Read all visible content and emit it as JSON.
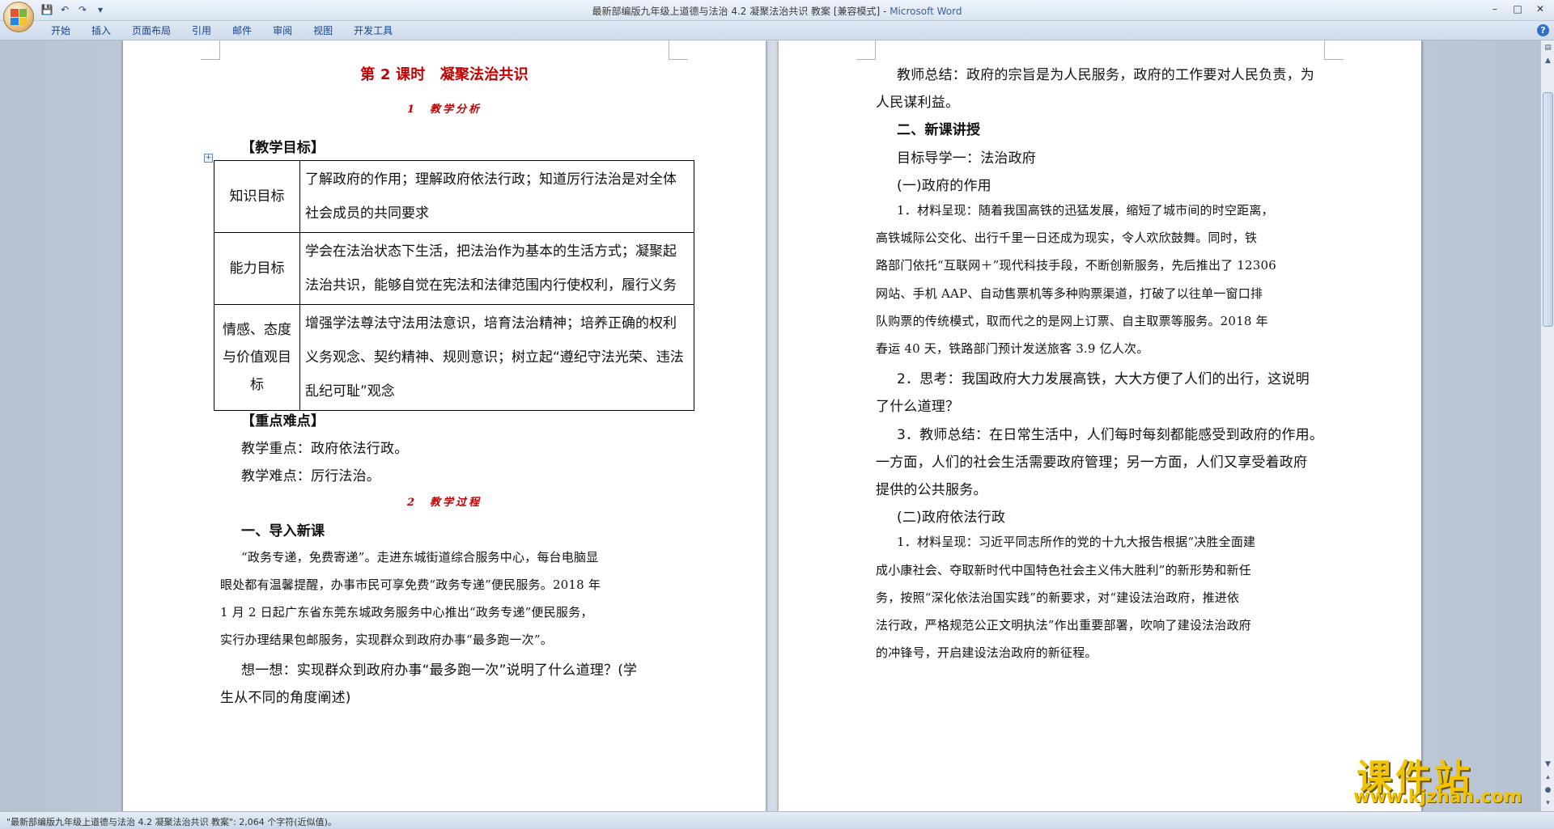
{
  "window": {
    "title": "最新部编版九年级上道德与法治 4.2 凝聚法治共识 教案 [兼容模式] - ",
    "app": "Microsoft Word"
  },
  "ribbon": {
    "tabs": [
      "开始",
      "插入",
      "页面布局",
      "引用",
      "邮件",
      "审阅",
      "视图",
      "开发工具"
    ]
  },
  "left_page": {
    "title": "第 2 课时　凝聚法治共识",
    "section1": "1　教学分析",
    "goals_heading": "【教学目标】",
    "goals": [
      {
        "label": "知识目标",
        "text": "了解政府的作用；理解政府依法行政；知道厉行法治是对全体社会成员的共同要求"
      },
      {
        "label": "能力目标",
        "text": "学会在法治状态下生活，把法治作为基本的生活方式；凝聚起法治共识，能够自觉在宪法和法律范围内行使权利，履行义务"
      },
      {
        "label": "情感、态度与价值观目标",
        "text": "增强学法尊法守法用法意识，培育法治精神；培养正确的权利义务观念、契约精神、规则意识；树立起“遵纪守法光荣、违法乱纪可耻”观念"
      }
    ],
    "key_heading": "【重点难点】",
    "key_point": "教学重点：政府依法行政。",
    "difficulty": "教学难点：厉行法治。",
    "section2": "2　教学过程",
    "intro_heading": "一、导入新课",
    "intro_lines": [
      "“政务专递，免费寄递”。走进东城街道综合服务中心，每台电脑显",
      "眼处都有温馨提醒，办事市民可享免费“政务专递”便民服务。2018 年",
      "1 月 2 日起广东省东莞东城政务服务中心推出“政务专递”便民服务，",
      "实行办理结果包邮服务，实现群众到政府办事“最多跑一次”。"
    ],
    "think_lines": [
      "想一想：实现群众到政府办事“最多跑一次”说明了什么道理？(学",
      "生从不同的角度阐述)"
    ]
  },
  "right_page": {
    "lines": [
      {
        "t": "教师总结：政府的宗旨是为人民服务，政府的工作要对人民负责，为",
        "style": "normal",
        "indent": true
      },
      {
        "t": "人民谋利益。",
        "style": "normal",
        "indent": false
      },
      {
        "t": "二、新课讲授",
        "style": "bold",
        "indent": true
      },
      {
        "t": "目标导学一：法治政府",
        "style": "normal",
        "indent": true
      },
      {
        "t": "(一)政府的作用",
        "style": "normal",
        "indent": true
      },
      {
        "t": "1．材料呈现：随着我国高铁的迅猛发展，缩短了城市间的时空距离，",
        "style": "serif",
        "indent": true
      },
      {
        "t": "高铁城际公交化、出行千里一日还成为现实，令人欢欣鼓舞。同时，铁",
        "style": "serif",
        "indent": false
      },
      {
        "t": "路部门依托“互联网＋”现代科技手段，不断创新服务，先后推出了 12306",
        "style": "serif",
        "indent": false
      },
      {
        "t": "网站、手机 AAP、自动售票机等多种购票渠道，打破了以往单一窗口排",
        "style": "serif",
        "indent": false
      },
      {
        "t": "队购票的传统模式，取而代之的是网上订票、自主取票等服务。2018 年",
        "style": "serif",
        "indent": false
      },
      {
        "t": "春运 40 天，铁路部门预计发送旅客 3.9 亿人次。",
        "style": "serif",
        "indent": false
      },
      {
        "t": "2．思考：我国政府大力发展高铁，大大方便了人们的出行，这说明",
        "style": "normal",
        "indent": true
      },
      {
        "t": "了什么道理？",
        "style": "normal",
        "indent": false
      },
      {
        "t": "3．教师总结：在日常生活中，人们每时每刻都能感受到政府的作用。",
        "style": "normal",
        "indent": true
      },
      {
        "t": "一方面，人们的社会生活需要政府管理；另一方面，人们又享受着政府",
        "style": "normal",
        "indent": false
      },
      {
        "t": "提供的公共服务。",
        "style": "normal",
        "indent": false
      },
      {
        "t": "(二)政府依法行政",
        "style": "normal",
        "indent": true
      },
      {
        "t": "1．材料呈现：习近平同志所作的党的十九大报告根据“决胜全面建",
        "style": "serif",
        "indent": true
      },
      {
        "t": "成小康社会、夺取新时代中国特色社会主义伟大胜利”的新形势和新任",
        "style": "serif",
        "indent": false
      },
      {
        "t": "务，按照“深化依法治国实践”的新要求，对“建设法治政府，推进依",
        "style": "serif",
        "indent": false
      },
      {
        "t": "法行政，严格规范公正文明执法”作出重要部署，吹响了建设法治政府",
        "style": "serif",
        "indent": false
      },
      {
        "t": "的冲锋号，开启建设法治政府的新征程。",
        "style": "serif",
        "indent": false
      }
    ]
  },
  "status": {
    "text": "\"最新部编版九年级上道德与法治 4.2 凝聚法治共识 教案\": 2,064 个字符(近似值)。"
  },
  "watermark": {
    "cn": "课件站",
    "url": "www.kjzhan.com"
  },
  "colors": {
    "heading_red": "#c00000",
    "ribbon_text": "#15428b",
    "watermark_yellow": "#f2c400"
  }
}
